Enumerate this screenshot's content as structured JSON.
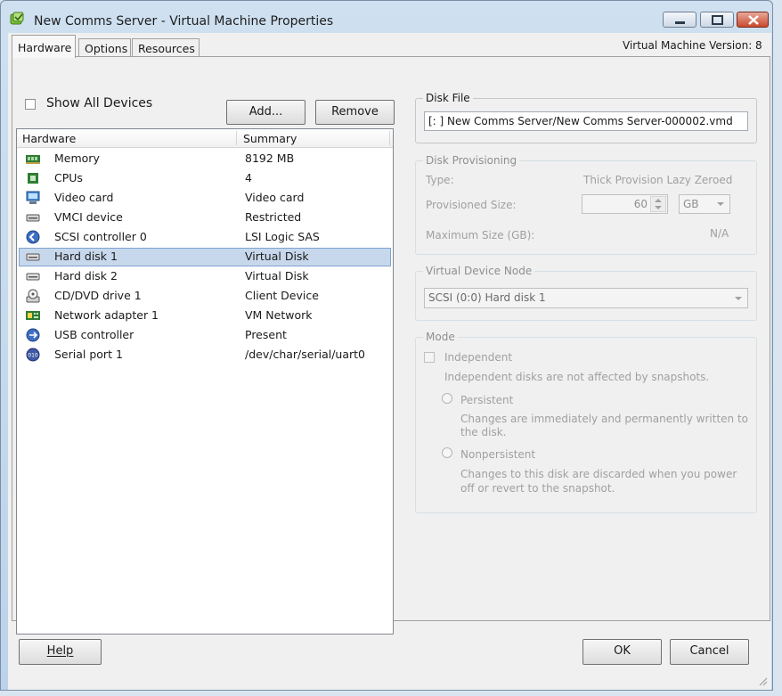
{
  "window": {
    "title": "New Comms Server - Virtual Machine Properties",
    "controls": {
      "minimize": "minimize-icon",
      "maximize": "maximize-icon",
      "close": "close-icon"
    }
  },
  "tabs": [
    {
      "label": "Hardware",
      "active": true
    },
    {
      "label": "Options",
      "active": false
    },
    {
      "label": "Resources",
      "active": false
    }
  ],
  "vm_version": "Virtual Machine Version: 8",
  "hardware_panel": {
    "show_all_devices_label": "Show All Devices",
    "add_button": "Add...",
    "remove_button": "Remove",
    "columns": {
      "hardware": "Hardware",
      "summary": "Summary"
    },
    "rows": [
      {
        "name": "Memory",
        "summary": "8192 MB",
        "icon": "memory-icon"
      },
      {
        "name": "CPUs",
        "summary": "4",
        "icon": "cpu-icon"
      },
      {
        "name": "Video card",
        "summary": "Video card",
        "icon": "video-card-icon"
      },
      {
        "name": "VMCI device",
        "summary": "Restricted",
        "icon": "vmci-device-icon"
      },
      {
        "name": "SCSI controller 0",
        "summary": "LSI Logic SAS",
        "icon": "scsi-controller-icon"
      },
      {
        "name": "Hard disk 1",
        "summary": "Virtual Disk",
        "icon": "hard-disk-icon",
        "selected": true
      },
      {
        "name": "Hard disk 2",
        "summary": "Virtual Disk",
        "icon": "hard-disk-icon"
      },
      {
        "name": "CD/DVD drive 1",
        "summary": "Client Device",
        "icon": "cd-dvd-icon"
      },
      {
        "name": "Network adapter 1",
        "summary": "VM Network",
        "icon": "network-adapter-icon"
      },
      {
        "name": "USB controller",
        "summary": "Present",
        "icon": "usb-controller-icon"
      },
      {
        "name": "Serial port 1",
        "summary": "/dev/char/serial/uart0",
        "icon": "serial-port-icon"
      }
    ]
  },
  "disk_file": {
    "legend": "Disk File",
    "value": "[:   ] New Comms Server/New Comms Server-000002.vmd"
  },
  "disk_provisioning": {
    "legend": "Disk Provisioning",
    "type_label": "Type:",
    "type_value": "Thick Provision Lazy Zeroed",
    "provisioned_size_label": "Provisioned Size:",
    "provisioned_size_value": "60",
    "unit": "GB",
    "max_size_label": "Maximum Size (GB):",
    "max_size_value": "N/A"
  },
  "virtual_device_node": {
    "legend": "Virtual Device Node",
    "selected": "SCSI (0:0) Hard disk 1"
  },
  "mode": {
    "legend": "Mode",
    "independent_label": "Independent",
    "independent_note": "Independent disks are not affected by snapshots.",
    "persistent_label": "Persistent",
    "persistent_note_1": "Changes are immediately and permanently written to",
    "persistent_note_2": "the disk.",
    "nonpersistent_label": "Nonpersistent",
    "nonpersistent_note_1": "Changes to this disk are discarded when you power",
    "nonpersistent_note_2": "off or revert to the snapshot."
  },
  "footer": {
    "help": "Help",
    "ok": "OK",
    "cancel": "Cancel"
  }
}
